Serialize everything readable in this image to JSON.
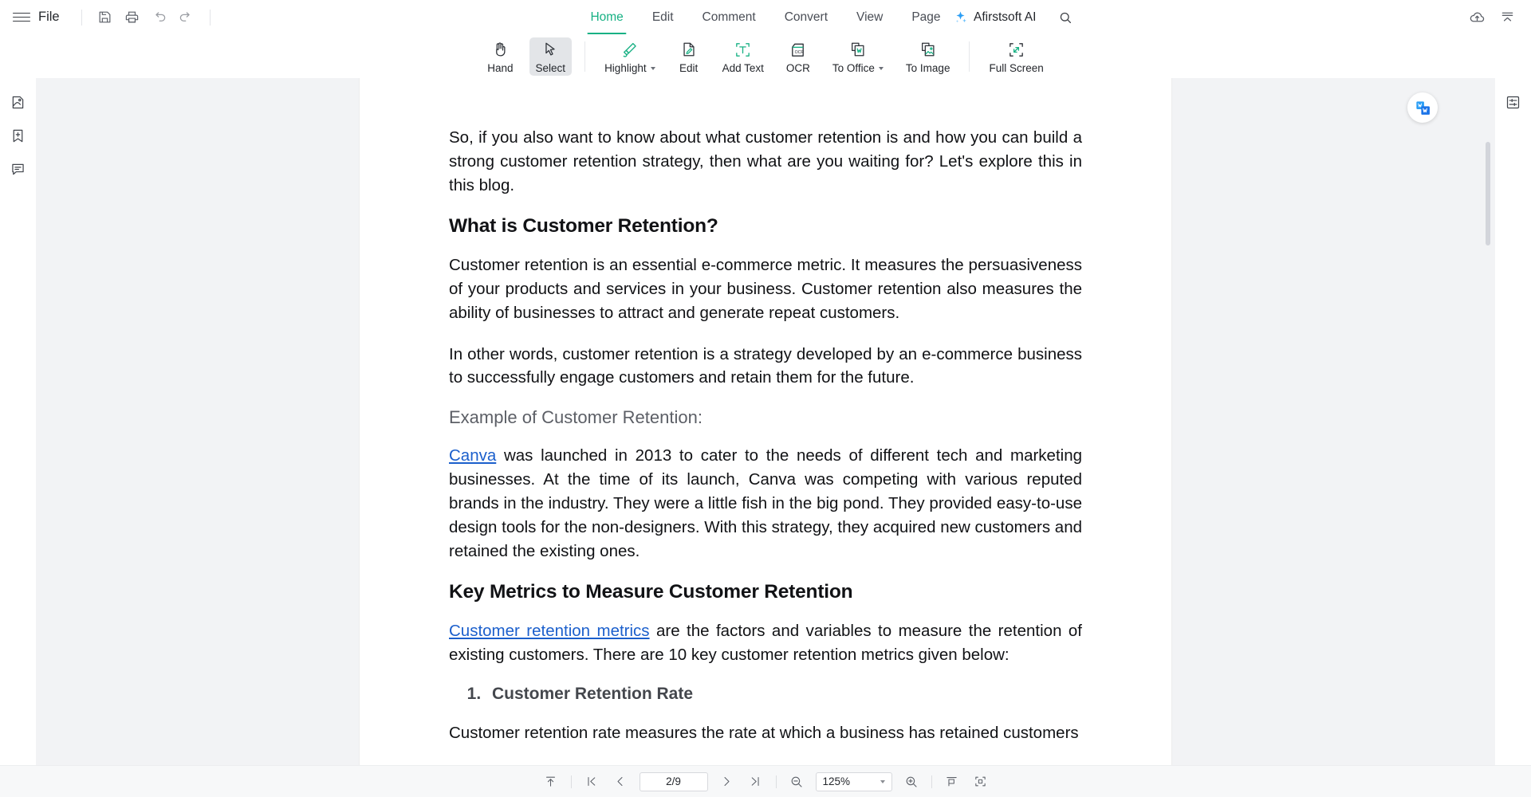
{
  "menubar": {
    "hamburger_icon": "hamburger-menu-icon",
    "file_label": "File",
    "quick_actions": [
      {
        "name": "save-button",
        "icon": "save-icon"
      },
      {
        "name": "print-button",
        "icon": "print-icon"
      },
      {
        "name": "undo-button",
        "icon": "undo-icon"
      },
      {
        "name": "redo-button",
        "icon": "redo-icon"
      }
    ],
    "tabs": [
      {
        "label": "Home",
        "active": true
      },
      {
        "label": "Edit",
        "active": false
      },
      {
        "label": "Comment",
        "active": false
      },
      {
        "label": "Convert",
        "active": false
      },
      {
        "label": "View",
        "active": false
      },
      {
        "label": "Page",
        "active": false
      }
    ],
    "ai_label": "Afirstsoft AI",
    "ai_icon": "sparkle-ai-icon",
    "search_icon": "search-icon",
    "right_actions": [
      {
        "name": "cloud-upload-button",
        "icon": "cloud-upload-icon"
      },
      {
        "name": "collapse-ribbon-button",
        "icon": "collapse-up-icon"
      }
    ],
    "accent_color": "#18b184"
  },
  "ribbon": {
    "tools": [
      {
        "label": "Hand",
        "icon": "hand-icon",
        "active": false,
        "dropdown": false
      },
      {
        "label": "Select",
        "icon": "cursor-select-icon",
        "active": true,
        "dropdown": false
      },
      {
        "label": "Highlight",
        "icon": "highlighter-pen-icon",
        "active": false,
        "dropdown": true
      },
      {
        "label": "Edit",
        "icon": "edit-document-icon",
        "active": false,
        "dropdown": false
      },
      {
        "label": "Add Text",
        "icon": "add-text-icon",
        "active": false,
        "dropdown": false
      },
      {
        "label": "OCR",
        "icon": "ocr-icon",
        "active": false,
        "dropdown": false
      },
      {
        "label": "To Office",
        "icon": "to-word-icon",
        "active": false,
        "dropdown": true
      },
      {
        "label": "To Image",
        "icon": "to-image-icon",
        "active": false,
        "dropdown": false
      },
      {
        "label": "Full Screen",
        "icon": "full-screen-icon",
        "active": false,
        "dropdown": false
      }
    ]
  },
  "left_rail": [
    {
      "name": "thumbnails-panel-button",
      "icon": "page-thumbnail-icon"
    },
    {
      "name": "bookmarks-panel-button",
      "icon": "bookmark-plus-icon"
    },
    {
      "name": "comments-panel-button",
      "icon": "comment-icon"
    }
  ],
  "right_rail": [
    {
      "name": "properties-panel-button",
      "icon": "sliders-settings-icon"
    }
  ],
  "floating": {
    "word_convert_badge": "convert-to-word-badge"
  },
  "document": {
    "paragraph_1": "So, if you also want to know about what customer retention is and how you can build a strong customer retention strategy, then what are you waiting for? Let's explore this in this blog.",
    "heading_1": "What is Customer Retention?",
    "paragraph_2": "Customer retention is an essential e-commerce metric. It measures the persuasiveness of your products and services in your business. Customer retention also measures the ability of businesses to attract and generate repeat customers.",
    "paragraph_3": "In other words, customer retention is a strategy developed by an e-commerce business to successfully engage customers and retain them for the future.",
    "subheading_1": "Example of Customer Retention:",
    "canva_link": "Canva",
    "paragraph_4_rest": " was launched in 2013 to cater to the needs of different tech and marketing businesses. At the time of its launch, Canva was competing with various reputed brands in the industry. They were a little fish in the big pond. They provided easy-to-use design tools for the non-designers. With this strategy, they acquired new customers and retained the existing ones.",
    "heading_2": "Key Metrics to Measure Customer Retention",
    "metrics_link": "Customer retention metrics",
    "paragraph_5_rest": " are the factors and variables to measure the retention of existing customers.  There are 10 key customer retention metrics given below:",
    "list_item_1": "Customer Retention Rate",
    "paragraph_6": "Customer retention rate measures the rate at which a business has retained customers",
    "link_color": "#1b5fcc"
  },
  "bottombar": {
    "scroll_top_icon": "scroll-to-top-icon",
    "first_page_icon": "first-page-icon",
    "prev_page_icon": "previous-page-icon",
    "page_value": "2/9",
    "next_page_icon": "next-page-icon",
    "last_page_icon": "last-page-icon",
    "zoom_out_icon": "zoom-out-icon",
    "zoom_value": "125%",
    "zoom_in_icon": "zoom-in-icon",
    "fit_width_icon": "fit-width-icon",
    "fit_page_icon": "fit-page-icon"
  }
}
